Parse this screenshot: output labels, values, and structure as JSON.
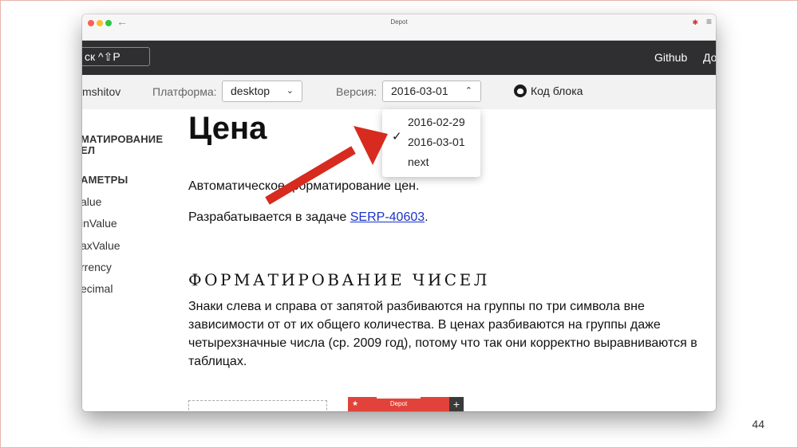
{
  "window": {
    "title": "Depot",
    "back_icon": "←",
    "menu_icon": "≡",
    "extension_icon": "✱"
  },
  "topbar": {
    "search_text": "ск ^⇧P",
    "nav": [
      "Github",
      "До"
    ]
  },
  "toolbar": {
    "user": "mshitov",
    "platform_label": "Платформа:",
    "platform_value": "desktop",
    "version_label": "Версия:",
    "version_value": "2016-03-01",
    "source_link": "Код блока"
  },
  "version_dropdown": {
    "options": [
      "2016-02-29",
      "2016-03-01",
      "next"
    ],
    "selected": "2016-03-01",
    "check_icon": "✓"
  },
  "sidebar": {
    "section1": "МАТИРОВАНИЕ\nЕЛ",
    "section2": "АМЕТРЫ",
    "items": [
      "alue",
      "inValue",
      "axValue",
      "rrency",
      "ecimal"
    ]
  },
  "content": {
    "title": "Цена",
    "intro_text": "Автоматическое форматирование цен.",
    "task_text": "Разрабатывается в задаче ",
    "task_link": "SERP-40603",
    "task_suffix": ".",
    "section_title": "ФОРМАТИРОВАНИЕ ЧИСЕЛ",
    "section_body": "Знаки слева и справа от запятой разбиваются на группы по три символа вне зависимости от от их общего количества. В ценах разбиваются на группы даже четырехзначные числа (ср. 2009 год), потому что так они корректно выравниваются в таблицах."
  },
  "tabbar": {
    "tab_label": "Depot",
    "star_icon": "★",
    "plus_icon": "+"
  },
  "slide": {
    "page_number": "44"
  },
  "colors": {
    "annotation_arrow": "#d62b1e",
    "topbar": "#2f2f31",
    "link": "#1b33c9",
    "tab": "#e1433b"
  }
}
